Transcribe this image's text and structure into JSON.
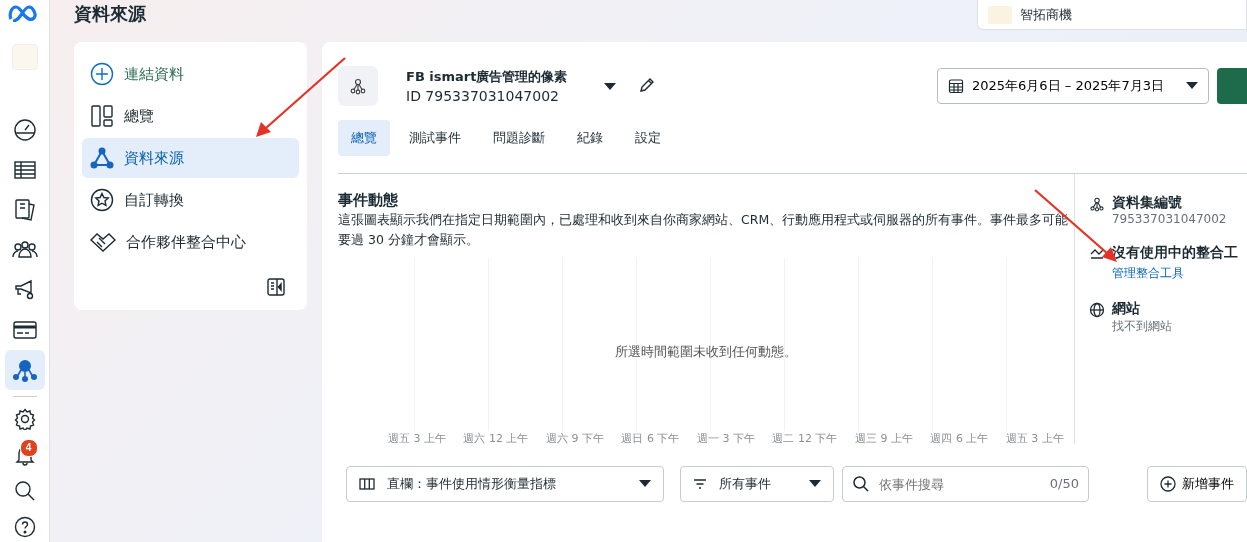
{
  "page_title": "資料來源",
  "account": {
    "name": "智拓商機"
  },
  "rail": {
    "items": [
      {
        "selected": false
      },
      {
        "selected": false
      },
      {
        "selected": false
      },
      {
        "selected": false
      },
      {
        "selected": false
      },
      {
        "selected": false
      },
      {
        "selected": true
      }
    ],
    "notification_badge": "4"
  },
  "sidebar": {
    "items": [
      {
        "kind": "action",
        "label": "連結資料",
        "selected": false
      },
      {
        "kind": "nav",
        "label": "總覽",
        "selected": false
      },
      {
        "kind": "nav",
        "label": "資料來源",
        "selected": true
      },
      {
        "kind": "nav",
        "label": "自訂轉換",
        "selected": false
      },
      {
        "kind": "nav",
        "label": "合作夥伴整合中心",
        "selected": false
      }
    ]
  },
  "dataset": {
    "name": "FB ismart廣告管理的像素",
    "id": "ID 795337031047002"
  },
  "date_range": "2025年6月6日 – 2025年7月3日",
  "tabs": [
    {
      "label": "總覽",
      "selected": true
    },
    {
      "label": "測試事件",
      "selected": false
    },
    {
      "label": "問題診斷",
      "selected": false
    },
    {
      "label": "紀錄",
      "selected": false
    },
    {
      "label": "設定",
      "selected": false
    }
  ],
  "activity": {
    "title": "事件動態",
    "description": "這張圖表顯示我們在指定日期範圍內，已處理和收到來自你商家網站、CRM、行動應用程式或伺服器的所有事件。事件最多可能要過 30 分鐘才會顯示。",
    "empty_message": "所選時間範圍未收到任何動態。",
    "x_labels": [
      "週五 3 上午",
      "週六 12 上午",
      "週六 9 下午",
      "週日 6 下午",
      "週一 3 下午",
      "週二 12 下午",
      "週三 9 上午",
      "週四 6 上午",
      "週五 3 上午"
    ]
  },
  "details": [
    {
      "title": "資料集編號",
      "value": "795337031047002",
      "kind": "text"
    },
    {
      "title": "沒有使用中的整合工",
      "value": "管理整合工具",
      "kind": "link"
    },
    {
      "title": "網站",
      "value": "找不到網站",
      "kind": "text"
    }
  ],
  "toolbar": {
    "columns_select": "直欄：事件使用情形衡量指標",
    "filter_select": "所有事件",
    "search": {
      "placeholder": "依事件搜尋",
      "count": "0/50"
    },
    "add_button": "新增事件"
  }
}
